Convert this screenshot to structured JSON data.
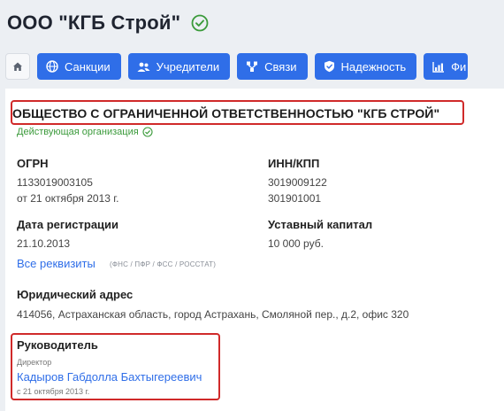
{
  "header": {
    "title": "ООО \"КГБ Строй\"",
    "verified_icon": "check-circle-icon"
  },
  "tabs": [
    {
      "label": "Санкции",
      "icon": "globe-icon"
    },
    {
      "label": "Учредители",
      "icon": "users-icon"
    },
    {
      "label": "Связи",
      "icon": "share-icon"
    },
    {
      "label": "Надежность",
      "icon": "shield-icon"
    },
    {
      "label": "Фи",
      "icon": "chart-icon"
    }
  ],
  "company": {
    "full_name": "ОБЩЕСТВО С ОГРАНИЧЕННОЙ ОТВЕТСТВЕННОСТЬЮ \"КГБ СТРОЙ\"",
    "status": "Действующая организация"
  },
  "details": {
    "ogrn_label": "ОГРН",
    "ogrn_value": "1133019003105",
    "ogrn_date": "от 21 октября 2013 г.",
    "inn_label": "ИНН/КПП",
    "inn_value": "3019009122",
    "kpp_value": "301901001",
    "reg_label": "Дата регистрации",
    "reg_value": "21.10.2013",
    "capital_label": "Уставный капитал",
    "capital_value": "10 000 руб.",
    "all_details_link": "Все реквизиты",
    "all_details_note": "(ФНС / ПФР / ФСС / РОССТАТ)"
  },
  "address": {
    "label": "Юридический адрес",
    "value": "414056, Астраханская область, город Астрахань, Смоляной пер., д.2, офис 320"
  },
  "manager": {
    "label": "Руководитель",
    "position": "Директор",
    "name": "Кадыров Габдолла Бахтыгереевич",
    "since": "с 21 октября 2013 г."
  },
  "colors": {
    "accent": "#2f6ee8",
    "alert": "#d02a2a",
    "success": "#3a9a3a"
  }
}
